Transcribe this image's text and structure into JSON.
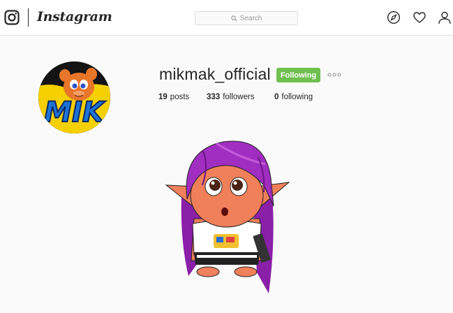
{
  "app": {
    "wordmark": "Instagram"
  },
  "search": {
    "placeholder": "Search"
  },
  "nav": {
    "icons": [
      "compass-icon",
      "heart-icon",
      "person-icon"
    ]
  },
  "profile": {
    "username": "mikmak_official",
    "follow_button": "Following",
    "stats": {
      "posts_count": "19",
      "posts_label": "posts",
      "followers_count": "333",
      "followers_label": "followers",
      "following_count": "0",
      "following_label": "following"
    },
    "avatar_logo_text": "MIK"
  },
  "colors": {
    "follow_button": "#70c050",
    "text": "#262626",
    "background": "#fafafa"
  }
}
